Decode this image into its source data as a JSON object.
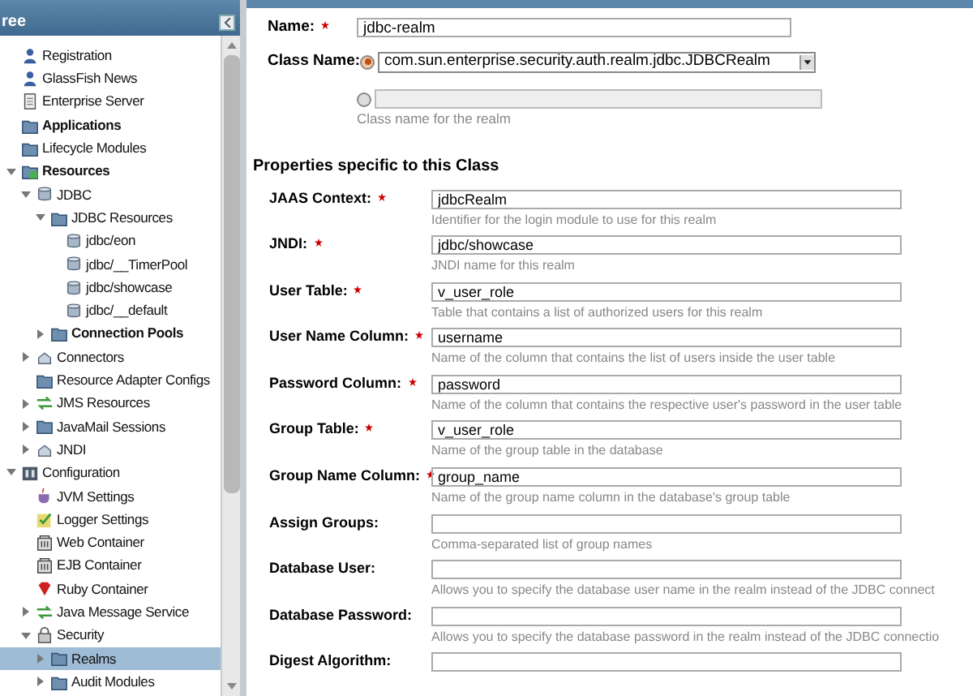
{
  "tree": {
    "title": "ree",
    "items": [
      {
        "label": "Registration",
        "kind": "person",
        "bold": false
      },
      {
        "label": "GlassFish News",
        "kind": "people",
        "bold": false
      },
      {
        "label": "Enterprise Server",
        "kind": "document",
        "bold": false
      },
      {
        "label": "Applications",
        "kind": "folder",
        "bold": true
      },
      {
        "label": "Lifecycle Modules",
        "kind": "folder",
        "bold": false
      },
      {
        "label": "Resources",
        "kind": "folder-green",
        "bold": true,
        "expanded": true,
        "children": [
          {
            "label": "JDBC",
            "kind": "database",
            "bold": false,
            "expanded": true,
            "children": [
              {
                "label": "JDBC Resources",
                "kind": "folder",
                "bold": false,
                "expanded": true,
                "children": [
                  {
                    "label": "jdbc/eon",
                    "kind": "database",
                    "bold": false
                  },
                  {
                    "label": "jdbc/__TimerPool",
                    "kind": "database",
                    "bold": false
                  },
                  {
                    "label": "jdbc/showcase",
                    "kind": "database",
                    "bold": false
                  },
                  {
                    "label": "jdbc/__default",
                    "kind": "database",
                    "bold": false
                  }
                ]
              },
              {
                "label": "Connection Pools",
                "kind": "folder",
                "bold": true,
                "expanded": false
              }
            ]
          },
          {
            "label": "Connectors",
            "kind": "plug",
            "bold": false,
            "expanded": false
          },
          {
            "label": "Resource Adapter Configs",
            "kind": "folder",
            "bold": false
          },
          {
            "label": "JMS Resources",
            "kind": "arrows",
            "bold": false,
            "expanded": false
          },
          {
            "label": "JavaMail Sessions",
            "kind": "folder",
            "bold": false,
            "expanded": false
          },
          {
            "label": "JNDI",
            "kind": "plug",
            "bold": false,
            "expanded": false
          }
        ]
      },
      {
        "label": "Configuration",
        "kind": "config",
        "bold": false,
        "expanded": true,
        "children": [
          {
            "label": "JVM Settings",
            "kind": "cup",
            "bold": false
          },
          {
            "label": "Logger Settings",
            "kind": "check",
            "bold": false
          },
          {
            "label": "Web Container",
            "kind": "box",
            "bold": false
          },
          {
            "label": "EJB Container",
            "kind": "box",
            "bold": false
          },
          {
            "label": "Ruby Container",
            "kind": "gem",
            "bold": false
          },
          {
            "label": "Java Message Service",
            "kind": "arrows",
            "bold": false,
            "expanded": false
          },
          {
            "label": "Security",
            "kind": "lock",
            "bold": false,
            "expanded": true,
            "children": [
              {
                "label": "Realms",
                "kind": "folder",
                "bold": false,
                "expanded": false,
                "selected": true
              },
              {
                "label": "Audit Modules",
                "kind": "folder",
                "bold": false,
                "expanded": false,
                "selected": false
              }
            ]
          }
        ]
      }
    ]
  },
  "form": {
    "name": {
      "label": "Name:",
      "required": true,
      "value": "jdbc-realm"
    },
    "class_name": {
      "label": "Class Name:",
      "options": [
        {
          "kind": "select",
          "selected": true,
          "value": "com.sun.enterprise.security.auth.realm.jdbc.JDBCRealm"
        },
        {
          "kind": "text",
          "selected": false
        }
      ],
      "hint": "Class name for the realm"
    },
    "section_title": "Properties specific to this Class",
    "fields": [
      {
        "label": "JAAS Context:",
        "required": true,
        "value": "jdbcRealm",
        "hint": "Identifier for the login module to use for this realm"
      },
      {
        "label": "JNDI:",
        "required": true,
        "value": "jdbc/showcase",
        "hint": "JNDI name for this realm"
      },
      {
        "label": "User Table:",
        "required": true,
        "value": "v_user_role",
        "hint": "Table that contains a list of authorized users for this realm"
      },
      {
        "label": "User Name Column:",
        "required": true,
        "value": "username",
        "hint": "Name of the column that contains the list of users inside the user table"
      },
      {
        "label": "Password Column:",
        "required": true,
        "value": "password",
        "hint": "Name of the column that contains the respective user's password in the user table"
      },
      {
        "label": "Group Table:",
        "required": true,
        "value": "v_user_role",
        "hint": "Name of the group table in the database"
      },
      {
        "label": "Group Name Column:",
        "required": true,
        "value": "group_name",
        "hint": "Name of the group name column in the database's group table"
      },
      {
        "label": "Assign Groups:",
        "required": false,
        "hint": "Comma-separated list of group names"
      },
      {
        "label": "Database User:",
        "required": false,
        "hint": "Allows you to specify the database user name in the realm instead of the JDBC connect"
      },
      {
        "label": "Database Password:",
        "required": false,
        "hint": "Allows you to specify the database password in the realm instead of the JDBC connectio"
      },
      {
        "label": "Digest Algorithm:",
        "required": false
      }
    ]
  }
}
